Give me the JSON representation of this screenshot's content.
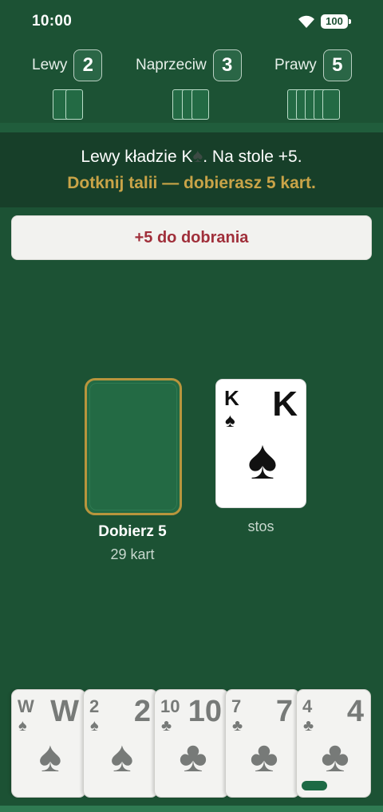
{
  "status": {
    "time": "10:00",
    "battery": "100"
  },
  "players": [
    {
      "name": "Lewy",
      "count": "2",
      "cards": 2
    },
    {
      "name": "Naprzeciw",
      "count": "3",
      "cards": 3
    },
    {
      "name": "Prawy",
      "count": "5",
      "cards": 5
    }
  ],
  "message": {
    "line1_before": "Lewy kładzie K",
    "line1_suit": "♠",
    "line1_after": ". Na stole +5.",
    "line2": "Dotknij talii — dobierasz 5 kart."
  },
  "penalty": {
    "label": "+5 do dobrania"
  },
  "deck": {
    "label": "Dobierz 5",
    "count": "29 kart"
  },
  "pile": {
    "rank": "K",
    "suit": "♠",
    "label": "stos"
  },
  "hand": [
    {
      "rank": "W",
      "suit": "♠"
    },
    {
      "rank": "2",
      "suit": "♠"
    },
    {
      "rank": "10",
      "suit": "♣"
    },
    {
      "rank": "7",
      "suit": "♣"
    },
    {
      "rank": "4",
      "suit": "♣"
    }
  ],
  "colors": {
    "table": "#1c5234",
    "accent_gold": "#c9a448",
    "penalty_red": "#a02f3a"
  }
}
